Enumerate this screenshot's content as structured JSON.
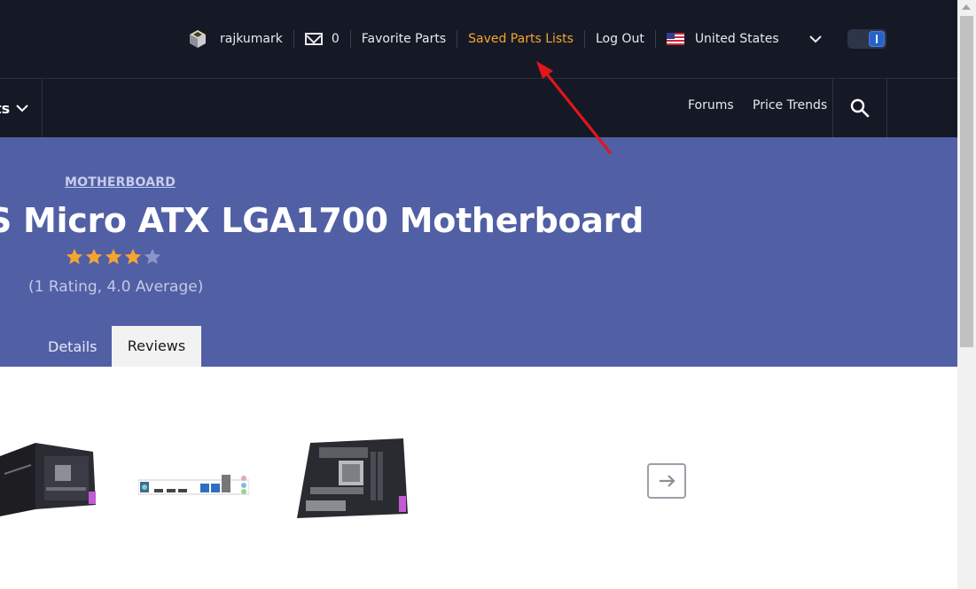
{
  "topnav": {
    "username": "rajkumark",
    "mail_count": "0",
    "favorite_parts": "Favorite Parts",
    "saved_parts_lists": "Saved Parts Lists",
    "log_out": "Log Out",
    "region": "United States"
  },
  "nav2": {
    "builds_fragment": "ts",
    "forums": "Forums",
    "price_trends": "Price Trends"
  },
  "hero": {
    "category": "MOTHERBOARD",
    "title": "S Micro ATX LGA1700 Motherboard",
    "rating_value": 4.0,
    "rating_text": "(1 Rating, 4.0 Average)",
    "tabs": [
      {
        "label": "Details",
        "active": false
      },
      {
        "label": "Reviews",
        "active": true
      }
    ]
  },
  "gallery": {
    "images": [
      "motherboard-box-image",
      "io-shield-image",
      "motherboard-angle-image"
    ],
    "next_icon": "arrow-right-icon"
  },
  "colors": {
    "header_bg": "#151925",
    "hero_bg": "#515fa5",
    "accent_link": "#f4a531",
    "star": "#f4a531",
    "annotation": "#e0161b"
  }
}
